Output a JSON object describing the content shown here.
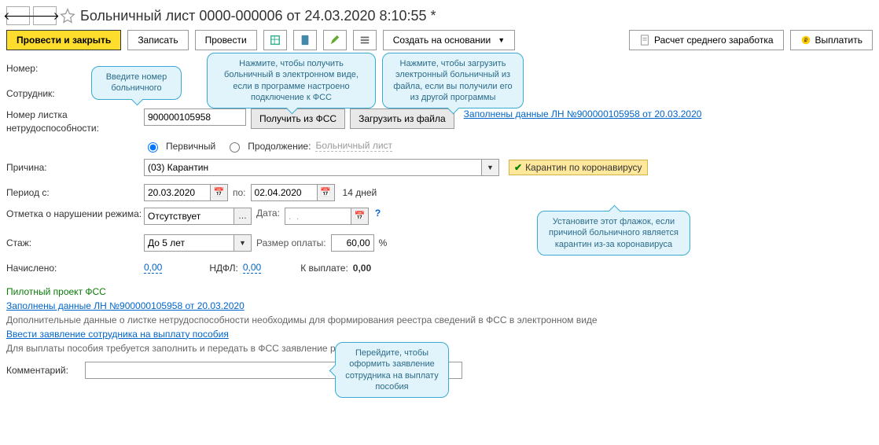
{
  "nav": {
    "back": "🡐",
    "forward": "🡒"
  },
  "title": "Больничный лист 0000-000006 от 24.03.2020 8:10:55 *",
  "toolbar": {
    "post_close": "Провести и закрыть",
    "write": "Записать",
    "post": "Провести",
    "create_based": "Создать на основании",
    "calc_avg": "Расчет среднего заработка",
    "pay": "Выплатить"
  },
  "callouts": {
    "c1": "Введите номер больничного",
    "c2": "Нажмите, чтобы получить больничный в электронном виде, если в программе настроено подключение к ФСС",
    "c3": "Нажмите, чтобы загрузить электронный больничный из файла, если вы получили его из другой программы",
    "c4": "Установите этот флажок, если причиной больничного является карантин из-за коронавируса",
    "c5": "Перейдите, чтобы оформить заявление сотрудника на выплату пособия"
  },
  "labels": {
    "number": "Номер:",
    "employee": "Сотрудник:",
    "sheet_number": "Номер листка нетрудоспособности:",
    "radio_primary": "Первичный",
    "radio_continuation": "Продолжение:",
    "continuation_placeholder": "Больничный лист",
    "reason": "Причина:",
    "covid_checkbox": "Карантин по коронавирусу",
    "period_from": "Период с:",
    "period_to": "по:",
    "days": "14 дней",
    "violation": "Отметка о нарушении режима:",
    "date": "Дата:",
    "date_placeholder": ".  .",
    "seniority": "Стаж:",
    "pay_rate": "Размер оплаты:",
    "accrued": "Начислено:",
    "ndfl": "НДФЛ:",
    "to_pay": "К выплате:",
    "pilot": "Пилотный проект ФСС",
    "ln_link1": "Заполнены данные ЛН №900000105958 от 20.03.2020",
    "ln_link2": "Заполнены данные ЛН №900000105958 от 20.03.2020",
    "extra_note": "Дополнительные данные о листке нетрудоспособности необходимы для формирования реестра сведений в ФСС в электронном виде",
    "apply_link": "Ввести заявление сотрудника на выплату пособия",
    "pay_note": "Для выплаты пособия требуется заполнить и передать в ФСС заявление работника",
    "comment": "Комментарий:"
  },
  "buttons": {
    "get_fss": "Получить из ФСС",
    "load_file": "Загрузить из файла"
  },
  "values": {
    "sheet_number": "900000105958",
    "reason": "(03) Карантин",
    "date_from": "20.03.2020",
    "date_to": "02.04.2020",
    "violation": "Отсутствует",
    "seniority": "До 5 лет",
    "pay_rate": "60,00",
    "percent": "%",
    "accrued": "0,00",
    "ndfl": "0,00",
    "to_pay": "0,00",
    "help": "?"
  }
}
